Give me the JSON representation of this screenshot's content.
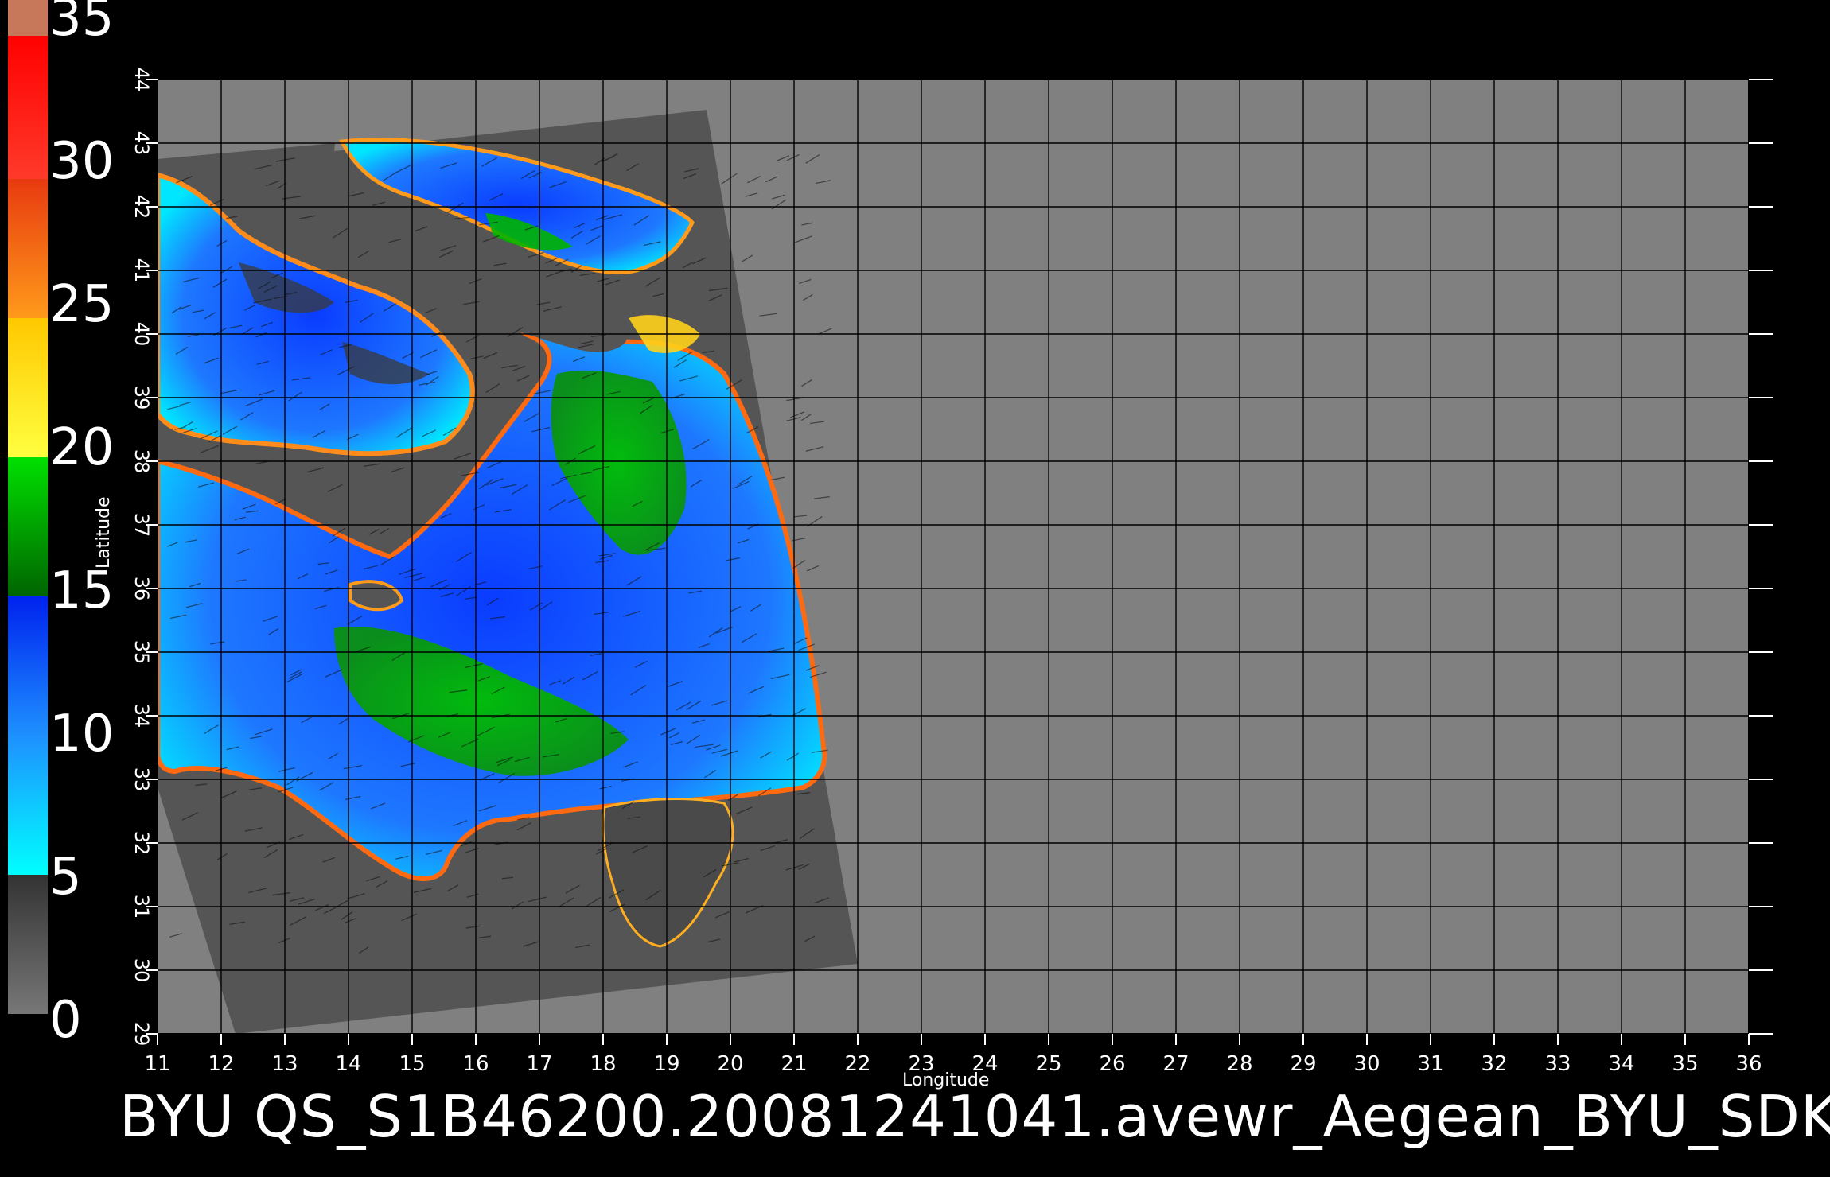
{
  "title": "BYU QS_S1B46200.20081241041.avewr_Aegean_BYU_SDK",
  "axes": {
    "x_label": "Longitude",
    "y_label": "Latitude",
    "lon_range": [
      11,
      36
    ],
    "lat_range": [
      29,
      44
    ],
    "lon_ticks": [
      "11",
      "12",
      "13",
      "14",
      "15",
      "16",
      "17",
      "18",
      "19",
      "20",
      "21",
      "22",
      "23",
      "24",
      "25",
      "26",
      "27",
      "28",
      "29",
      "30",
      "31",
      "32",
      "33",
      "34",
      "35",
      "36"
    ],
    "lat_ticks": [
      "29",
      "30",
      "31",
      "32",
      "33",
      "34",
      "35",
      "36",
      "37",
      "38",
      "39",
      "40",
      "41",
      "42",
      "43",
      "44"
    ]
  },
  "colorbar": {
    "labels": [
      "0",
      "5",
      "10",
      "15",
      "20",
      "25",
      "30",
      "35"
    ],
    "range": [
      0,
      35
    ],
    "colors": {
      "0-5": "#6e6e6e",
      "5-10": "#00e6ff",
      "10-15": "#0033ff",
      "15-20": "#00c800",
      "20-25": "#ffff33",
      "25-30": "#ff8c1a",
      "30-35": "#ff1a1a",
      "35": "#c8785a"
    }
  },
  "colors": {
    "background": "#000000",
    "plot_fill": "#808080",
    "swath_fill": "#555555",
    "grid": "#000000"
  }
}
